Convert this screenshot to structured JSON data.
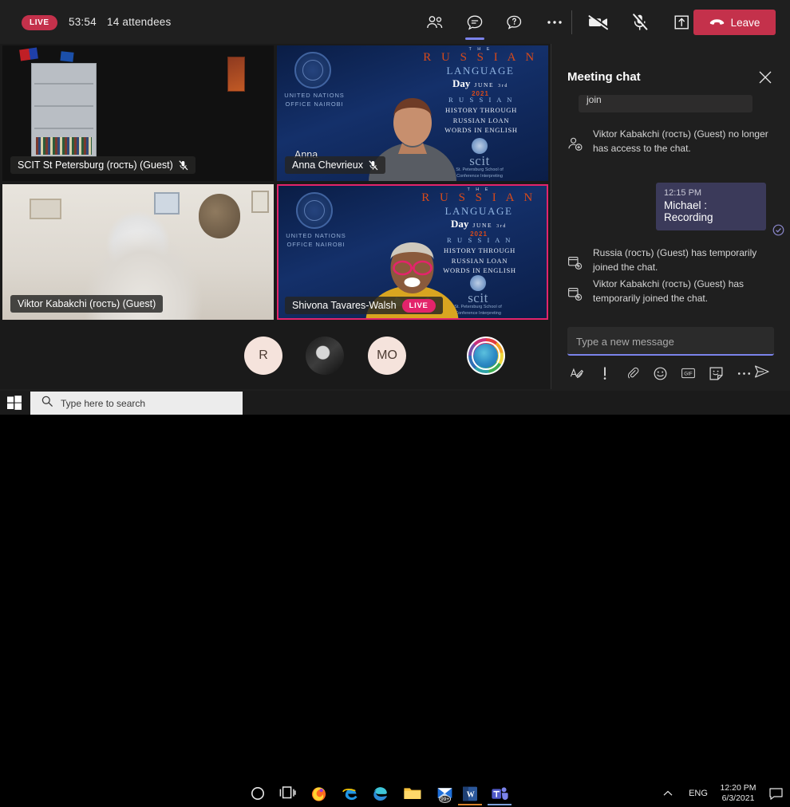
{
  "meeting": {
    "live_badge": "LIVE",
    "timer": "53:54",
    "attendees": "14 attendees",
    "leave_label": "Leave",
    "accent_purple": "#7b83eb",
    "accent_red": "#c4314b",
    "active_speaker_border": "#e3246b",
    "toolbar_icons": [
      {
        "name": "people-icon",
        "label": "Show participants"
      },
      {
        "name": "chat-icon",
        "label": "Show conversation",
        "active": true
      },
      {
        "name": "qna-icon",
        "label": "Q&A"
      },
      {
        "name": "more-options-icon",
        "label": "More actions"
      },
      {
        "name": "camera-off-icon",
        "label": "Turn camera on"
      },
      {
        "name": "mic-off-icon",
        "label": "Unmute"
      },
      {
        "name": "share-icon",
        "label": "Share content"
      }
    ]
  },
  "tiles": [
    {
      "name": "SCIT St Petersburg (гость) (Guest)",
      "muted": true,
      "live": false,
      "background": "webcam"
    },
    {
      "name": "Anna Chevrieux",
      "overlay_name": "Anna",
      "muted": true,
      "live": false,
      "background": "russian-language-day"
    },
    {
      "name": "Viktor Kabakchi (гость) (Guest)",
      "muted": false,
      "live": false,
      "background": "webcam"
    },
    {
      "name": "Shivona Tavares-Walsh",
      "muted": false,
      "live": true,
      "live_label": "LIVE",
      "background": "russian-language-day"
    }
  ],
  "virtual_background": {
    "un_line1": "UNITED NATIONS",
    "un_line2": "OFFICE NAIROBI",
    "the": "T H E",
    "russian": "R U S S I A N",
    "language": "LANGUAGE",
    "day": "Day",
    "june": "JUNE",
    "ordinal": "3rd",
    "year": "2021",
    "sub1": "R U S S I A N",
    "sub2": "HISTORY THROUGH",
    "sub3": "RUSSIAN LOAN",
    "sub4": "WORDS IN ENGLISH",
    "scit": "scit",
    "scit_sub1": "St. Petersburg School of",
    "scit_sub2": "Conference Interpreting"
  },
  "avatars": [
    {
      "name": "avatar-r",
      "initials": "R",
      "type": "initials"
    },
    {
      "name": "avatar-photo",
      "initials": "",
      "type": "photo"
    },
    {
      "name": "avatar-mo",
      "initials": "MO",
      "type": "initials"
    },
    {
      "name": "avatar-globe",
      "initials": "",
      "type": "logo"
    }
  ],
  "chat": {
    "title": "Meeting chat",
    "close_label": "Close",
    "cut_off_message": "join",
    "messages": [
      {
        "kind": "system",
        "icon": "person-add-icon",
        "text": "Viktor Kabakchi (гость) (Guest) no longer has access to the chat."
      },
      {
        "kind": "own",
        "time": "12:15 PM",
        "text": "Michael : Recording",
        "read_receipt": "read-receipt-icon"
      },
      {
        "kind": "system",
        "icon": "chat-join-icon",
        "text": "Russia (гость) (Guest) has temporarily joined the chat."
      },
      {
        "kind": "system",
        "icon": "chat-join-icon",
        "text": "Viktor Kabakchi (гость) (Guest) has temporarily joined the chat."
      }
    ],
    "composer_placeholder": "Type a new message",
    "composer_value": "",
    "composer_icons": [
      {
        "name": "format-icon",
        "label": "Format"
      },
      {
        "name": "important-icon",
        "label": "Set delivery options"
      },
      {
        "name": "attach-icon",
        "label": "Attach file"
      },
      {
        "name": "emoji-icon",
        "label": "Emoji"
      },
      {
        "name": "gif-icon",
        "label": "GIF"
      },
      {
        "name": "sticker-icon",
        "label": "Sticker"
      },
      {
        "name": "more-icon",
        "label": "More options"
      }
    ],
    "send_label": "Send"
  },
  "taskbar": {
    "start_label": "Start",
    "search_placeholder": "Type here to search",
    "items": [
      {
        "name": "cortana-icon",
        "label": "Cortana"
      },
      {
        "name": "task-view-icon",
        "label": "Task View"
      },
      {
        "name": "firefox-icon",
        "label": "Firefox"
      },
      {
        "name": "internet-explorer-icon",
        "label": "Internet Explorer"
      },
      {
        "name": "microsoft-edge-icon",
        "label": "Microsoft Edge"
      },
      {
        "name": "file-explorer-icon",
        "label": "File Explorer"
      },
      {
        "name": "mail-icon",
        "label": "Mail",
        "badge": "99+"
      },
      {
        "name": "word-icon",
        "label": "Word"
      },
      {
        "name": "teams-icon",
        "label": "Microsoft Teams"
      }
    ],
    "tray": {
      "chevron": "show-hidden-icons",
      "language": "ENG",
      "time": "12:20 PM",
      "date": "6/3/2021",
      "notifications": "notification-icon"
    }
  }
}
